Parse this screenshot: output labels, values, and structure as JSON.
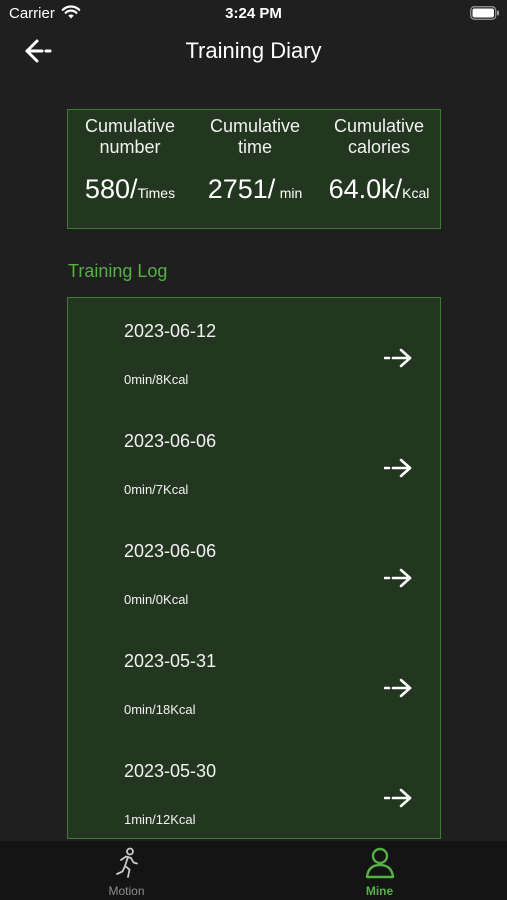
{
  "status_bar": {
    "carrier": "Carrier",
    "time": "3:24 PM"
  },
  "nav": {
    "title": "Training Diary"
  },
  "stats": [
    {
      "label": "Cumulative number",
      "value": "580/",
      "unit": "Times"
    },
    {
      "label": "Cumulative time",
      "value": "2751/",
      "unit": "min"
    },
    {
      "label": "Cumulative calories",
      "value": "64.0k/",
      "unit": "Kcal"
    }
  ],
  "training_log": {
    "title": "Training Log",
    "items": [
      {
        "date": "2023-06-12",
        "detail": "0min/8Kcal"
      },
      {
        "date": "2023-06-06",
        "detail": "0min/7Kcal"
      },
      {
        "date": "2023-06-06",
        "detail": "0min/0Kcal"
      },
      {
        "date": "2023-05-31",
        "detail": "0min/18Kcal"
      },
      {
        "date": "2023-05-30",
        "detail": "1min/12Kcal"
      }
    ]
  },
  "tabs": [
    {
      "label": "Motion",
      "icon": "runner-icon",
      "active": false
    },
    {
      "label": "Mine",
      "icon": "person-icon",
      "active": true
    }
  ],
  "colors": {
    "accent": "#55b046",
    "card_bg": "#23361f",
    "card_border": "#3f7a34",
    "page_bg": "#1f1f1f"
  }
}
